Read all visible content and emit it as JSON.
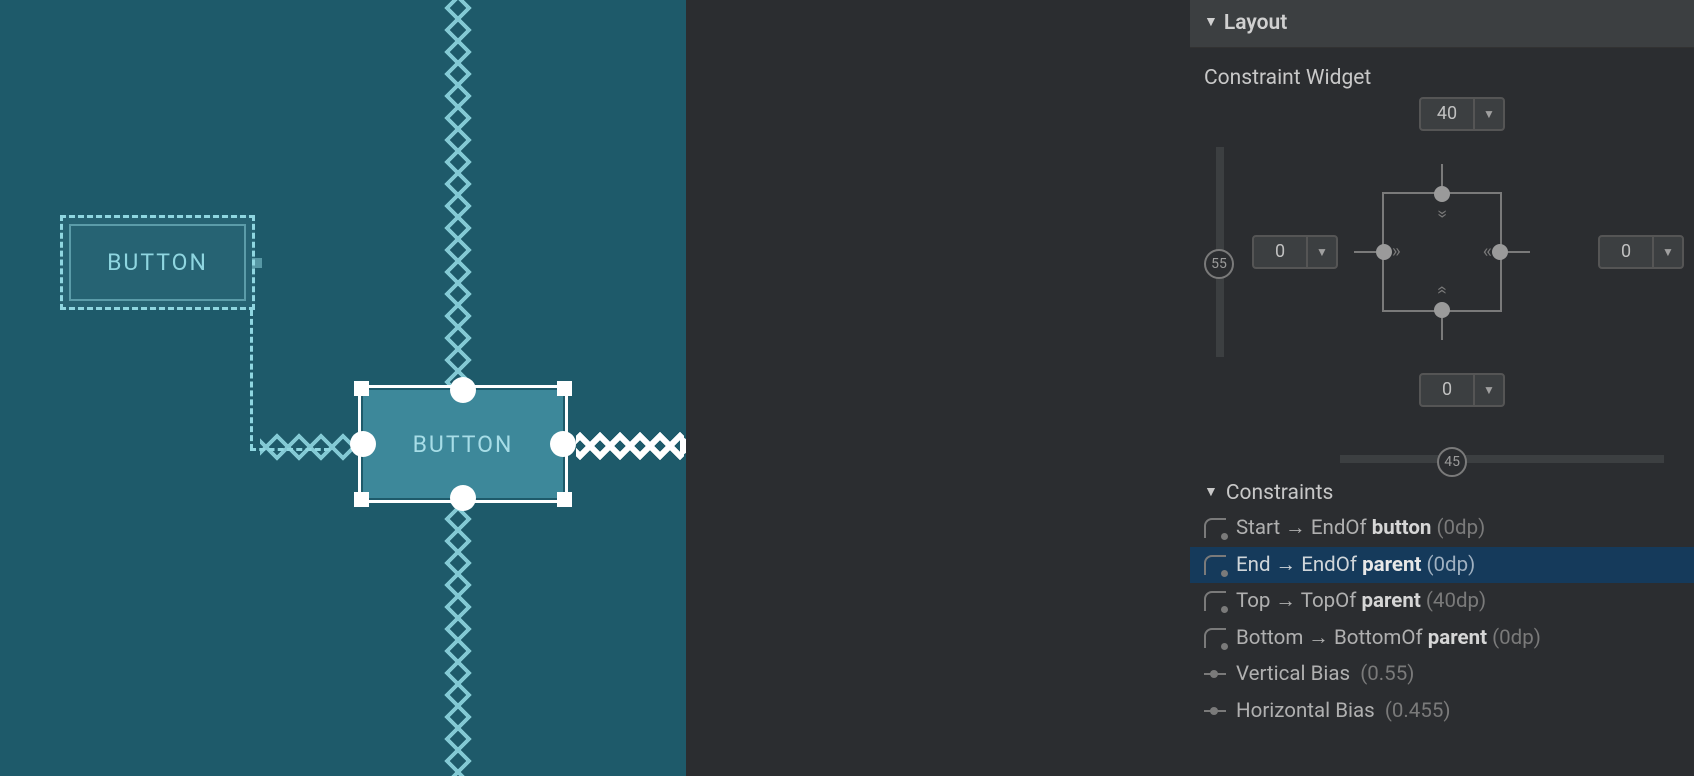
{
  "designer": {
    "button_ghost_label": "BUTTON",
    "button_selected_label": "BUTTON"
  },
  "inspector": {
    "layout_header": "Layout",
    "constraint_widget_label": "Constraint Widget",
    "margins": {
      "top": "40",
      "bottom": "0",
      "left": "0",
      "right": "0"
    },
    "bias": {
      "vertical": "55",
      "horizontal": "45"
    },
    "constraints_header": "Constraints",
    "constraints": [
      {
        "prefix": "Start → EndOf",
        "target": "button",
        "suffix": "(0dp)",
        "selected": false
      },
      {
        "prefix": "End → EndOf",
        "target": "parent",
        "suffix": "(0dp)",
        "selected": true
      },
      {
        "prefix": "Top → TopOf",
        "target": "parent",
        "suffix": "(40dp)",
        "selected": false
      },
      {
        "prefix": "Bottom → BottomOf",
        "target": "parent",
        "suffix": "(0dp)",
        "selected": false
      }
    ],
    "bias_rows": [
      {
        "label": "Vertical Bias",
        "value": "(0.55)"
      },
      {
        "label": "Horizontal Bias",
        "value": "(0.455)"
      }
    ]
  }
}
